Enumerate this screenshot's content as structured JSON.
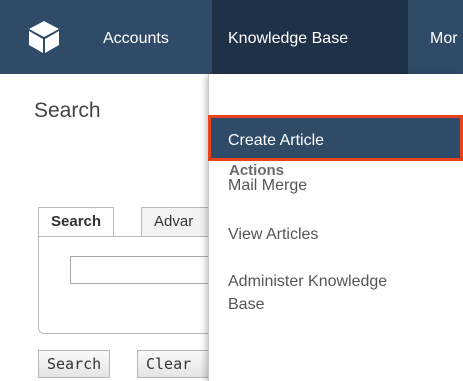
{
  "nav": {
    "logo_icon": "cube-logo-icon",
    "accounts": "Accounts",
    "knowledge_base": "Knowledge Base",
    "more": "Mor"
  },
  "page": {
    "title": "Search",
    "tabs": [
      "Search",
      "Advar"
    ],
    "search_value": "",
    "buttons": {
      "search": "Search",
      "clear": "Clear"
    }
  },
  "menu": {
    "header": "Actions",
    "items": [
      "Create Article",
      "Mail Merge",
      "View Articles",
      "Administer Knowledge Base"
    ],
    "selected_index": 0
  },
  "colors": {
    "navbar": "#2f4b68",
    "navbar_active": "#1e3146",
    "highlight_border": "#e8421f"
  }
}
